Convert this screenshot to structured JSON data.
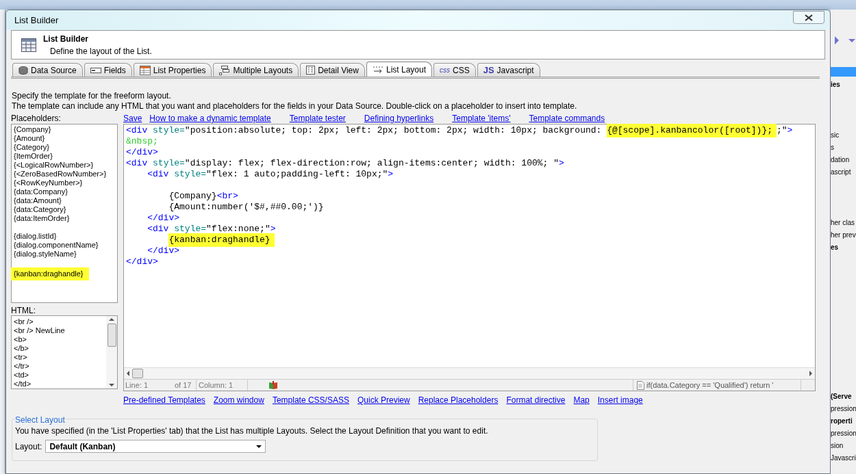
{
  "window": {
    "title": "List Builder"
  },
  "header": {
    "title": "List Builder",
    "subtitle": "Define the layout of the List."
  },
  "tabs": [
    {
      "label": "Data Source",
      "selected": false
    },
    {
      "label": "Fields",
      "selected": false
    },
    {
      "label": "List Properties",
      "selected": false
    },
    {
      "label": "Multiple Layouts",
      "selected": false
    },
    {
      "label": "Detail View",
      "selected": false
    },
    {
      "label": "List Layout",
      "selected": true
    },
    {
      "label": "CSS",
      "badge": "css",
      "selected": false
    },
    {
      "label": "Javascript",
      "badge": "JS",
      "selected": false
    }
  ],
  "description": [
    "Specify the template for the freeform layout.",
    "The template can include any HTML that you want and placeholders for the fields in your Data Source. Double-click on a placeholder to insert into template."
  ],
  "placeholders": {
    "label": "Placeholders:",
    "groups": [
      [
        {
          "text": "{Company}",
          "highlighted": false
        },
        {
          "text": "{Amount}",
          "highlighted": false
        },
        {
          "text": "{Category}",
          "highlighted": false
        },
        {
          "text": "{ItemOrder}",
          "highlighted": false
        },
        {
          "text": "{<LogicalRowNumber>}",
          "highlighted": false
        },
        {
          "text": "{<ZeroBasedRowNumber>}",
          "highlighted": false
        },
        {
          "text": "{<RowKeyNumber>}",
          "highlighted": false
        },
        {
          "text": "{data:Company}",
          "highlighted": false
        },
        {
          "text": "{data:Amount}",
          "highlighted": false
        },
        {
          "text": "{data:Category}",
          "highlighted": false
        },
        {
          "text": "{data:ItemOrder}",
          "highlighted": false
        }
      ],
      [
        {
          "text": "{dialog.listId}",
          "highlighted": false
        },
        {
          "text": "{dialog.componentName}",
          "highlighted": false
        },
        {
          "text": "{dialog.styleName}",
          "highlighted": false
        }
      ],
      [
        {
          "text": "{kanban:draghandle}",
          "highlighted": true
        }
      ]
    ]
  },
  "html_list": {
    "label": "HTML:",
    "items": [
      "<br />",
      "<br /> NewLine",
      "<b>",
      "</b>",
      "<tr>",
      "</tr>",
      "<td>",
      "</td>"
    ]
  },
  "top_links": [
    "Save",
    "How to make a dynamic template",
    "Template tester",
    "Defining hyperlinks",
    "Template 'items'",
    "Template commands"
  ],
  "editor": {
    "blocks": [
      [
        {
          "segments": [
            {
              "kind": "tag",
              "text": "<div",
              "highlighted": false
            },
            {
              "kind": "attr",
              "text": " style=",
              "highlighted": false
            },
            {
              "kind": "value",
              "text": "\"position:absolute; top: 2px; left: 2px; bottom: 2px; width: 10px; background: ",
              "highlighted": false
            },
            {
              "kind": "value",
              "text": "{@[scope].kanbancolor([root])};",
              "highlighted": true
            },
            {
              "kind": "value",
              "text": ";\"",
              "highlighted": false
            },
            {
              "kind": "tag",
              "text": ">",
              "highlighted": false
            }
          ]
        },
        {
          "segments": [
            {
              "kind": "entity",
              "text": "&nbsp;",
              "highlighted": false
            }
          ]
        },
        {
          "segments": [
            {
              "kind": "tag",
              "text": "</div>",
              "highlighted": false
            }
          ]
        },
        {
          "segments": [
            {
              "kind": "tag",
              "text": "<div",
              "highlighted": false
            },
            {
              "kind": "attr",
              "text": " style=",
              "highlighted": false
            },
            {
              "kind": "value",
              "text": "\"display: flex; flex-direction:row; align-items:center; width: 100%; \"",
              "highlighted": false
            },
            {
              "kind": "tag",
              "text": ">",
              "highlighted": false
            }
          ]
        },
        {
          "segments": [
            {
              "kind": "tag",
              "text": "    <div",
              "highlighted": false
            },
            {
              "kind": "attr",
              "text": " style=",
              "highlighted": false
            },
            {
              "kind": "value",
              "text": "\"flex: 1 auto;padding-left: 10px;\"",
              "highlighted": false
            },
            {
              "kind": "tag",
              "text": ">",
              "highlighted": false
            }
          ]
        }
      ],
      [
        {
          "segments": [
            {
              "kind": "value",
              "text": "        {Company}",
              "highlighted": false
            },
            {
              "kind": "tag",
              "text": "<br>",
              "highlighted": false
            }
          ]
        },
        {
          "segments": [
            {
              "kind": "value",
              "text": "        {Amount:number('$#,##0.00;')}",
              "highlighted": false
            }
          ]
        },
        {
          "segments": [
            {
              "kind": "tag",
              "text": "    </div>",
              "highlighted": false
            }
          ]
        },
        {
          "segments": [
            {
              "kind": "tag",
              "text": "    <div",
              "highlighted": false
            },
            {
              "kind": "attr",
              "text": " style=",
              "highlighted": false
            },
            {
              "kind": "value",
              "text": "\"flex:none;\"",
              "highlighted": false
            },
            {
              "kind": "tag",
              "text": ">",
              "highlighted": false
            }
          ]
        },
        {
          "segments": [
            {
              "kind": "value",
              "text": "        {kanban:draghandle}",
              "highlighted": true
            }
          ]
        },
        {
          "segments": [
            {
              "kind": "tag",
              "text": "    </div>",
              "highlighted": false
            }
          ]
        },
        {
          "segments": [
            {
              "kind": "tag",
              "text": "</div>",
              "highlighted": false
            }
          ]
        }
      ]
    ]
  },
  "status_bar": {
    "line": "Line: 1",
    "of": "of 17",
    "column": "Column: 1",
    "expression": "if(data.Category == 'Qualified') return '"
  },
  "bottom_links": [
    "Pre-defined Templates",
    "Zoom window",
    "Template CSS/SASS",
    "Quick Preview",
    "Replace Placeholders",
    "Format directive",
    "Map",
    "Insert image"
  ],
  "select_layout": {
    "legend": "Select Layout",
    "text": "You have specified (in the 'List Properties' tab) that the List has multiple Layouts. Select the Layout Definition that you want to edit.",
    "label": "Layout:",
    "value": "Default (Kanban)"
  },
  "background_panel": {
    "groups": [
      [
        {
          "text": "ies",
          "bold": true
        }
      ],
      [
        {
          "text": "sic",
          "bold": false
        },
        {
          "text": "s",
          "bold": false
        },
        {
          "text": "dation",
          "bold": false
        },
        {
          "text": "ascript",
          "bold": false
        }
      ],
      [
        {
          "text": "her clas",
          "bold": false
        },
        {
          "text": "her prev",
          "bold": false
        },
        {
          "text": "es",
          "bold": true
        }
      ],
      [
        {
          "text": "(Serve",
          "bold": true
        },
        {
          "text": "pression",
          "bold": false
        },
        {
          "text": "roperti",
          "bold": true
        },
        {
          "text": "pression",
          "bold": false
        },
        {
          "text": "sion",
          "bold": false
        },
        {
          "text": "Javascri",
          "bold": false
        }
      ]
    ]
  }
}
